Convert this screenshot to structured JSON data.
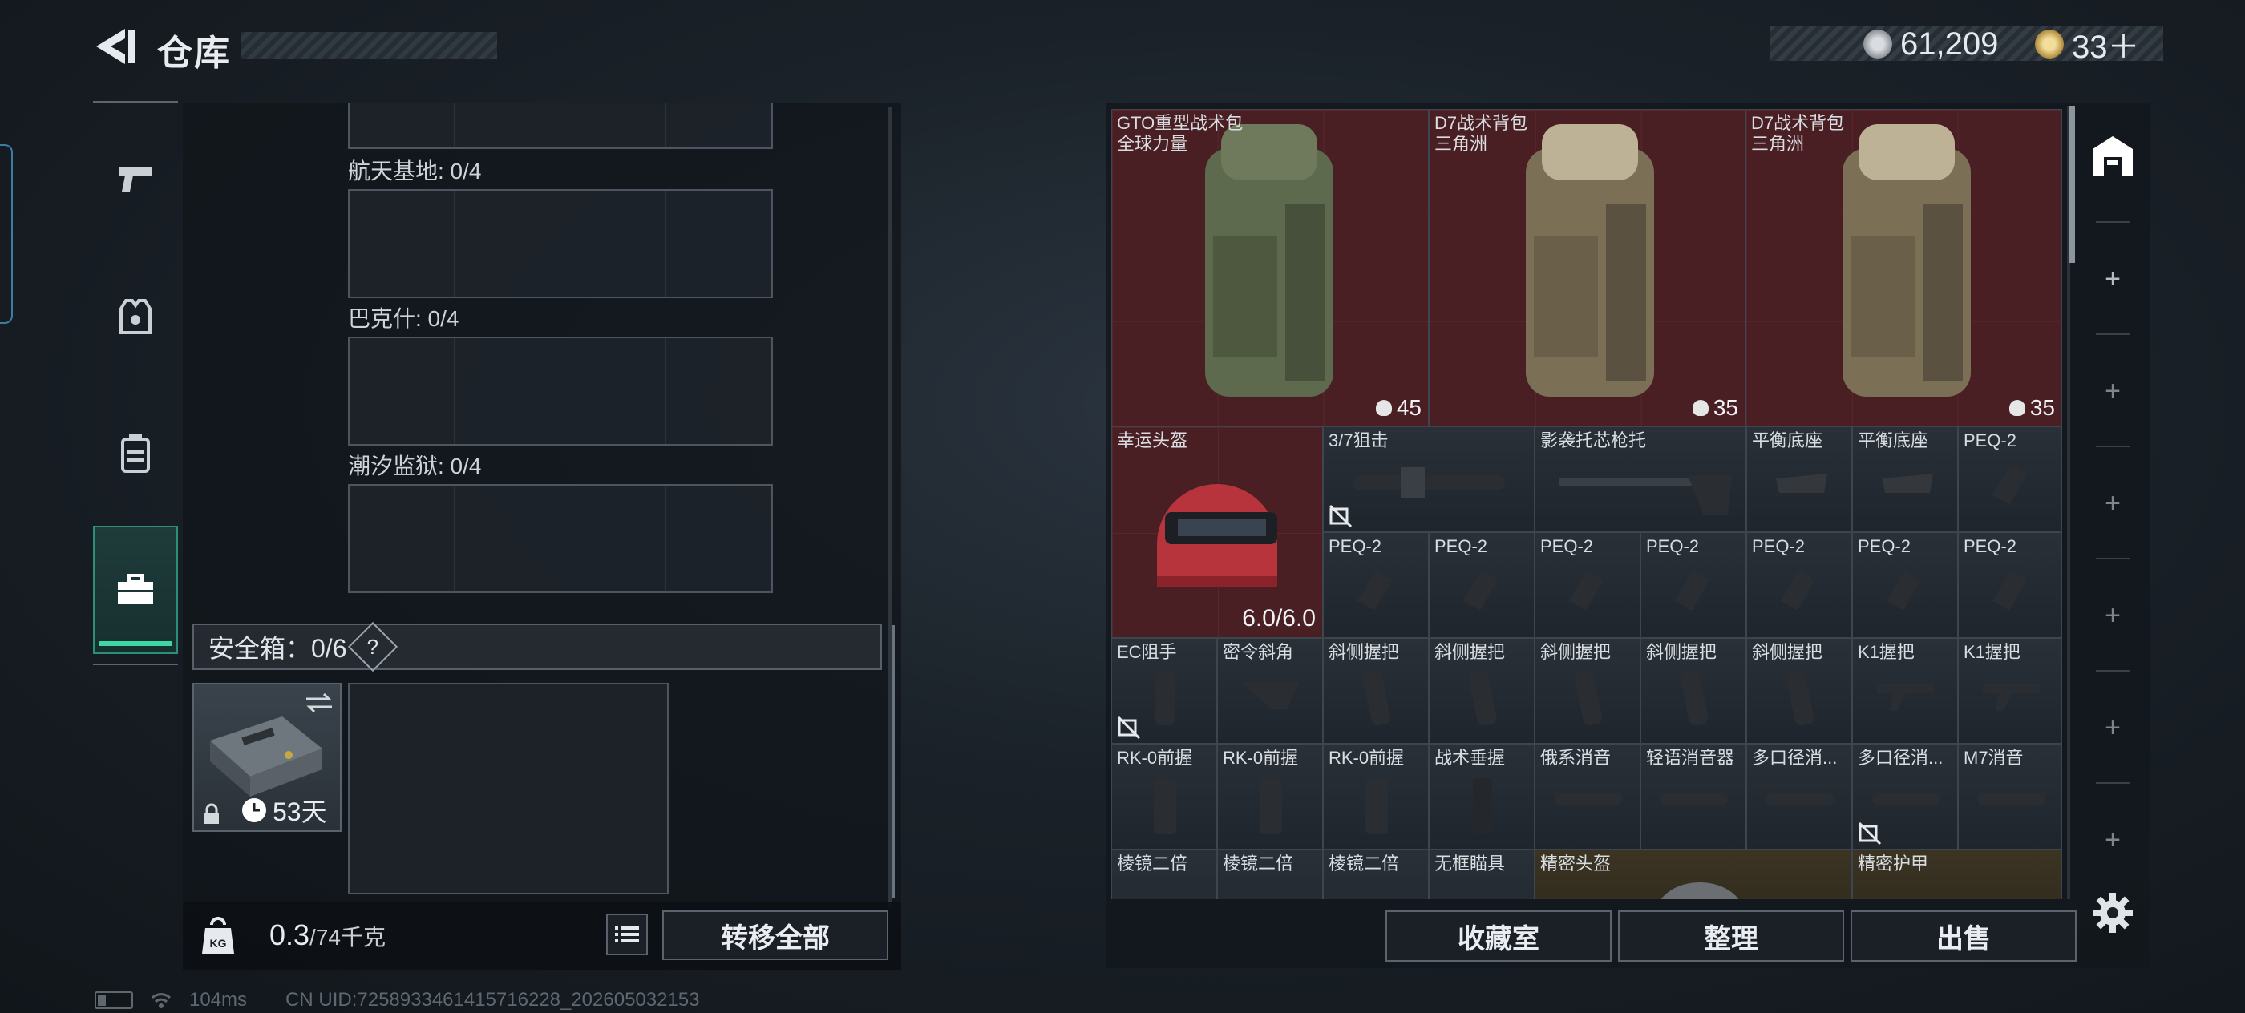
{
  "header": {
    "title": "仓库",
    "currency_1": "61,209",
    "currency_2": "33＋"
  },
  "nav": {
    "items": [
      "weapons",
      "armor-vest",
      "backpack",
      "toolbox"
    ],
    "active": "toolbox"
  },
  "left_panel": {
    "maps": [
      {
        "label": "航天基地: 0/4"
      },
      {
        "label": "巴克什: 0/4"
      },
      {
        "label": "潮汐监狱: 0/4"
      }
    ],
    "safe_box": {
      "title": "安全箱：0/6",
      "help": "?",
      "days": "53天"
    },
    "weight": {
      "current": "0.3",
      "capacity": "/74千克"
    },
    "transfer_all": "转移全部"
  },
  "stash": {
    "backpacks": [
      {
        "name": "GTO重型战术包",
        "sub": "全球力量",
        "count": "45"
      },
      {
        "name": "D7战术背包",
        "sub": "三角洲",
        "count": "35"
      },
      {
        "name": "D7战术背包",
        "sub": "三角洲",
        "count": "35"
      }
    ],
    "helmet": {
      "name": "幸运头盔",
      "durability": "6.0/6.0"
    },
    "row2": [
      "3/7狙击",
      "影袭托芯枪托",
      "平衡底座",
      "平衡底座",
      "PEQ-2"
    ],
    "row3": [
      "PEQ-2",
      "PEQ-2",
      "PEQ-2",
      "PEQ-2",
      "PEQ-2",
      "PEQ-2",
      "PEQ-2"
    ],
    "row4": [
      "EC阻手",
      "密令斜角",
      "斜侧握把",
      "斜侧握把",
      "斜侧握把",
      "斜侧握把",
      "斜侧握把",
      "K1握把",
      "K1握把"
    ],
    "row5": [
      "RK-0前握",
      "RK-0前握",
      "RK-0前握",
      "战术垂握",
      "俄系消音",
      "轻语消音器",
      "多口径消...",
      "多口径消...",
      "M7消音"
    ],
    "row6": [
      "棱镜二倍",
      "棱镜二倍",
      "棱镜二倍",
      "无框瞄具",
      "精密头盔",
      "精密护甲"
    ]
  },
  "bottom_buttons": {
    "collection": "收藏室",
    "organize": "整理",
    "sell": "出售"
  },
  "status_bar": {
    "ping": "104ms",
    "uid": "CN UID:7258933461415716228_202605032153"
  }
}
